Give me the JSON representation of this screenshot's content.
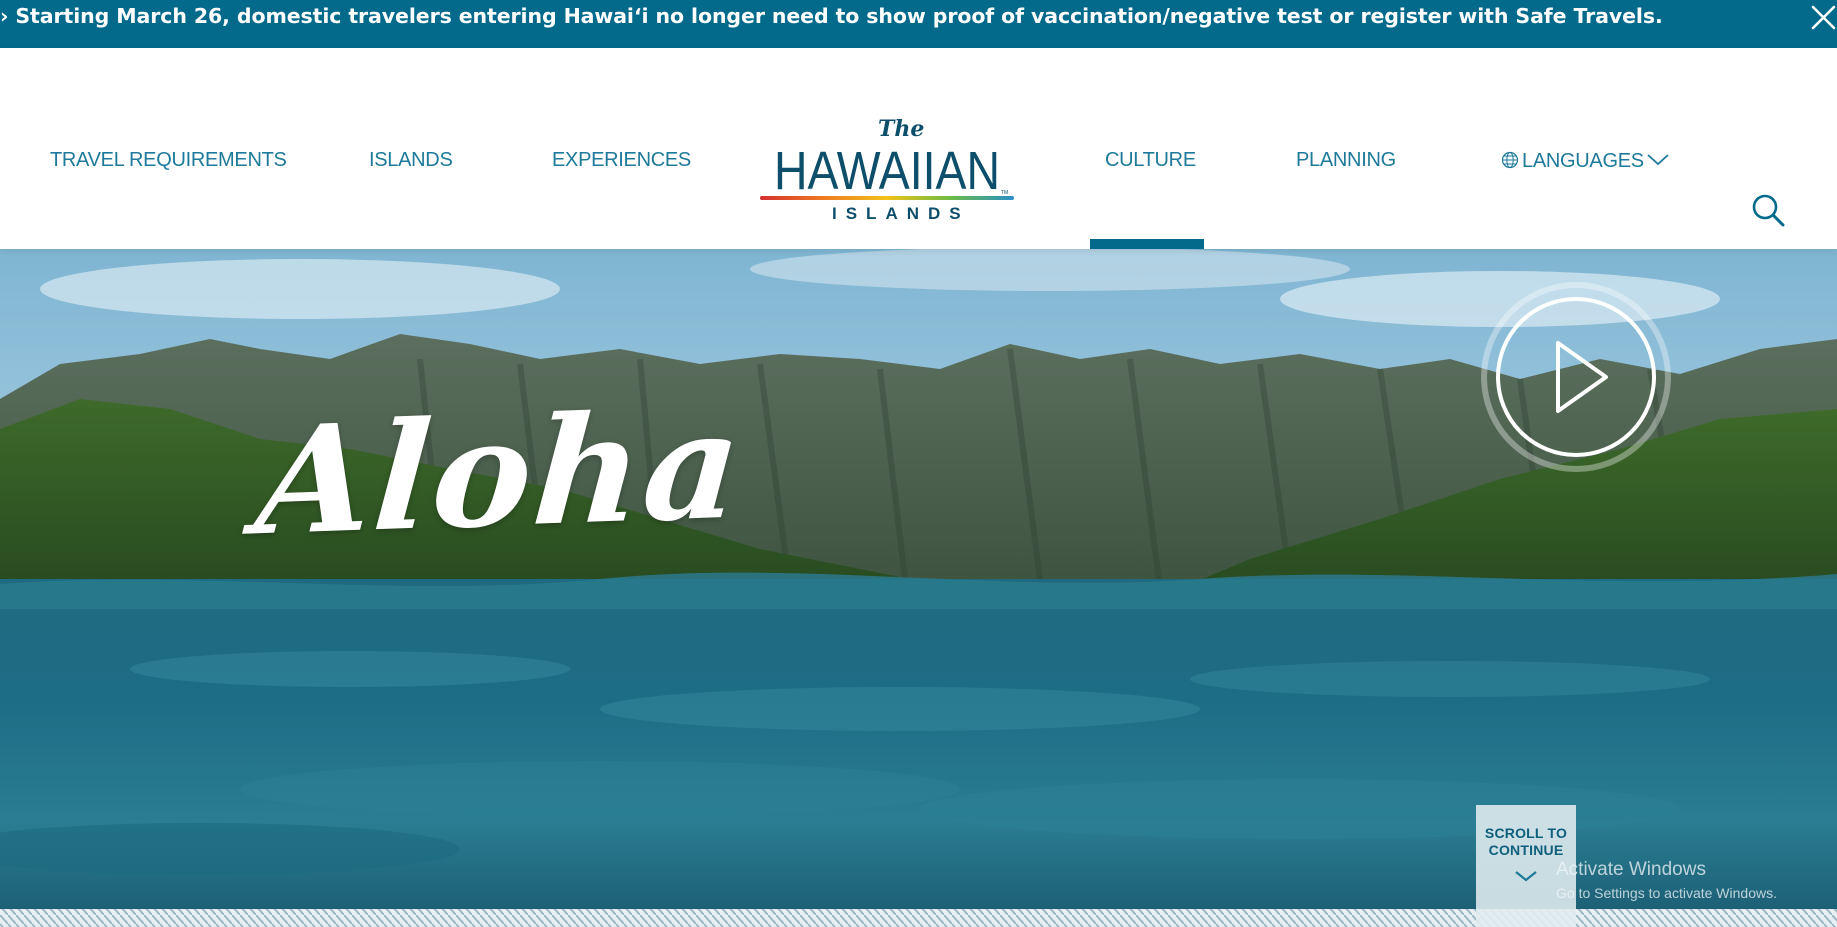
{
  "alert": {
    "message": "› Starting March 26, domestic travelers entering Hawaiʻi no longer need to show proof of vaccination/negative test or register with Safe Travels.",
    "close_icon": "close-icon",
    "background": "#046a8c"
  },
  "nav": {
    "items": [
      {
        "label": "TRAVEL REQUIREMENTS"
      },
      {
        "label": "ISLANDS"
      },
      {
        "label": "EXPERIENCES"
      },
      {
        "label": "CULTURE",
        "active": true
      },
      {
        "label": "PLANNING"
      },
      {
        "label": "LANGUAGES",
        "icon": "globe-icon",
        "trailing_icon": "chevron-down-icon"
      }
    ],
    "search_icon": "search-icon",
    "accent": "#1e7a9a",
    "active_indicator": "#046a8c"
  },
  "logo": {
    "the": "The",
    "hawaiian": "HAWAIIAN",
    "islands": "ISLANDS",
    "tm": "TM"
  },
  "hero": {
    "headline": "Aloha",
    "play_icon": "play-icon",
    "scroll_label_line1": "SCROLL TO",
    "scroll_label_line2": "CONTINUE",
    "scroll_icon": "chevron-down-icon"
  },
  "watermark": {
    "title": "Activate Windows",
    "subtitle": "Go to Settings to activate Windows."
  }
}
